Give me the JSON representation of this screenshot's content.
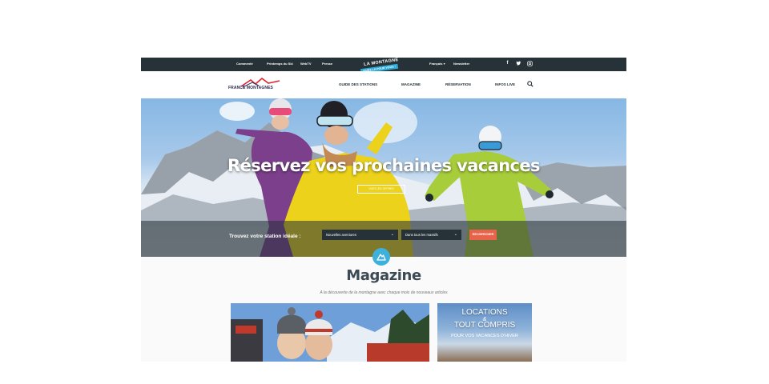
{
  "topbar": {
    "links": [
      "Commenté",
      "Printemps du Ski",
      "WebTV",
      "Presse"
    ],
    "badge_title": "LA MONTAGNE",
    "badge_tag": "VIVEZ-LA POUR VOUS !",
    "language": "Français",
    "newsletter": "Newsletter",
    "social": [
      "facebook-icon",
      "twitter-icon",
      "instagram-icon"
    ]
  },
  "nav": {
    "logo_text": "FRANCE MONTAGNES",
    "items": [
      "GUIDE DES STATIONS",
      "MAGAZINE",
      "RÉSERVATION",
      "INFOS LIVE"
    ]
  },
  "hero": {
    "title": "Réservez vos prochaines vacances",
    "cta": "VOIR LES OFFRES",
    "search_label": "Trouvez votre station idéale :",
    "select_experience": "Nouvelles aventures",
    "select_massif": "Dans tous les massifs",
    "submit": "RECHERCHER"
  },
  "magazine": {
    "title": "Magazine",
    "subtitle": "A la découverte de la montagne avec chaque mois de nouveaux articles",
    "promo_line1": "LOCATIONS",
    "promo_amp": "&",
    "promo_line2": "TOUT COMPRIS",
    "promo_line3": "POUR VOS VACANCES D'HIVER"
  },
  "colors": {
    "topbar": "#263138",
    "accent_blue": "#3fb0dc",
    "cta_orange": "#e8634a"
  }
}
